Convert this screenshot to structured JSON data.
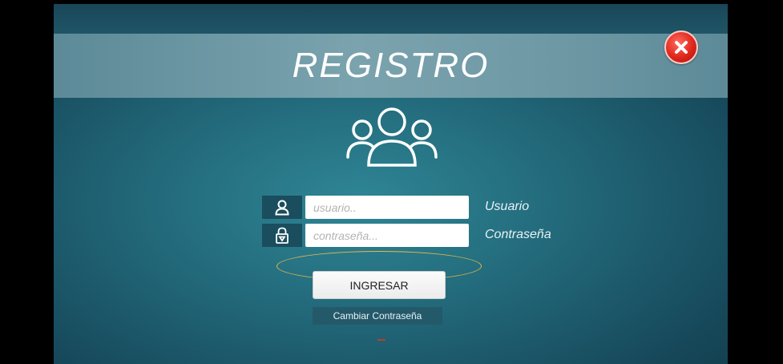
{
  "header": {
    "title": "REGISTRO"
  },
  "form": {
    "user": {
      "placeholder": "usuario..",
      "label": "Usuario",
      "icon": "user-icon"
    },
    "password": {
      "placeholder": "contraseña...",
      "label": "Contraseña",
      "icon": "lock-icon"
    },
    "submit_label": "INGRESAR",
    "change_password_label": "Cambiar Contraseña"
  },
  "icons": {
    "close": "close-icon",
    "group": "users-group-icon"
  },
  "colors": {
    "close_button": "#e0261a",
    "highlight_ellipse": "#e8b84a",
    "background": "#22697a"
  }
}
